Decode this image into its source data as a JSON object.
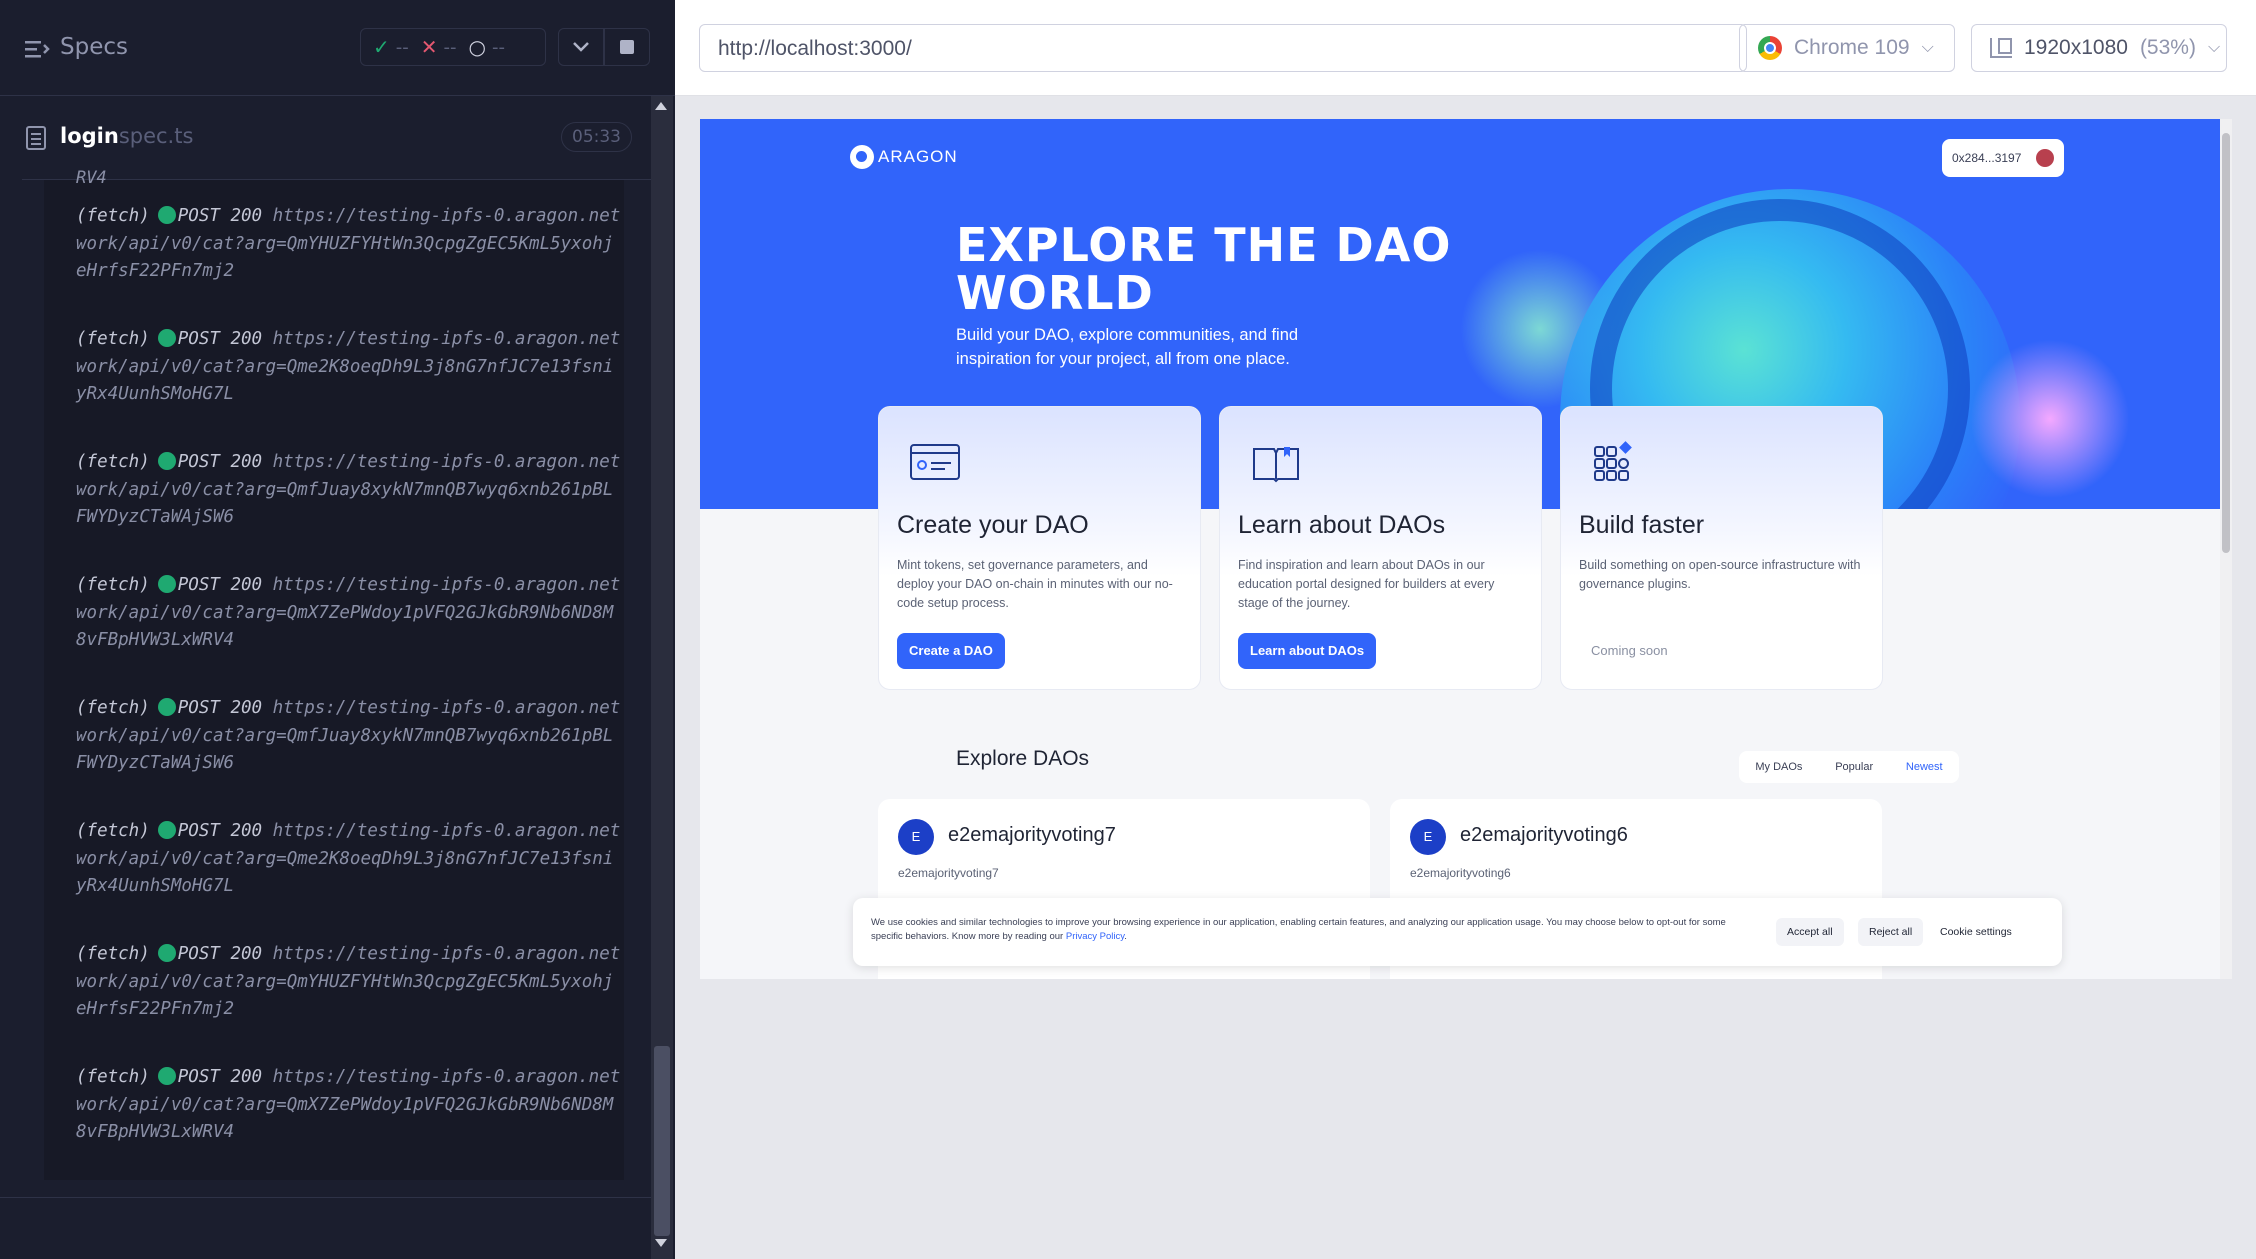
{
  "runner": {
    "title": "Specs",
    "stats": {
      "passed": "--",
      "failed": "--",
      "pending": "--"
    },
    "spec": {
      "name": "login",
      "ext": "spec.ts",
      "duration": "05:33"
    },
    "cut_line": "RV4",
    "logs": [
      {
        "tag": "(fetch)",
        "method": "POST 200",
        "url": "https://testing-ipfs-0.aragon.network/api/v0/cat?arg=QmYHUZFYHtWn3QcpgZgEC5KmL5yxohjeHrfsF22PFn7mj2"
      },
      {
        "tag": "(fetch)",
        "method": "POST 200",
        "url": "https://testing-ipfs-0.aragon.network/api/v0/cat?arg=Qme2K8oeqDh9L3j8nG7nfJC7e13fsniyRx4UunhSMoHG7L"
      },
      {
        "tag": "(fetch)",
        "method": "POST 200",
        "url": "https://testing-ipfs-0.aragon.network/api/v0/cat?arg=QmfJuay8xykN7mnQB7wyq6xnb261pBLFWYDyzCTaWAjSW6"
      },
      {
        "tag": "(fetch)",
        "method": "POST 200",
        "url": "https://testing-ipfs-0.aragon.network/api/v0/cat?arg=QmX7ZePWdoy1pVFQ2GJkGbR9Nb6ND8M8vFBpHVW3LxWRV4"
      },
      {
        "tag": "(fetch)",
        "method": "POST 200",
        "url": "https://testing-ipfs-0.aragon.network/api/v0/cat?arg=QmfJuay8xykN7mnQB7wyq6xnb261pBLFWYDyzCTaWAjSW6"
      },
      {
        "tag": "(fetch)",
        "method": "POST 200",
        "url": "https://testing-ipfs-0.aragon.network/api/v0/cat?arg=Qme2K8oeqDh9L3j8nG7nfJC7e13fsniyRx4UunhSMoHG7L"
      },
      {
        "tag": "(fetch)",
        "method": "POST 200",
        "url": "https://testing-ipfs-0.aragon.network/api/v0/cat?arg=QmYHUZFYHtWn3QcpgZgEC5KmL5yxohjeHrfsF22PFn7mj2"
      },
      {
        "tag": "(fetch)",
        "method": "POST 200",
        "url": "https://testing-ipfs-0.aragon.network/api/v0/cat?arg=QmX7ZePWdoy1pVFQ2GJkGbR9Nb6ND8M8vFBpHVW3LxWRV4"
      }
    ]
  },
  "aut": {
    "url": "http://localhost:3000/",
    "browser": "Chrome 109",
    "viewport": "1920x1080",
    "scale": "(53%)"
  },
  "app": {
    "logo_text": "ARAGON",
    "wallet": "0x284...3197",
    "hero_title": "EXPLORE THE DAO WORLD",
    "hero_sub": "Build your DAO, explore communities, and find inspiration for your project, all from one place.",
    "cards": [
      {
        "title": "Create your DAO",
        "desc": "Mint tokens, set governance parameters, and deploy your DAO on-chain in minutes with our no-code setup process.",
        "button": "Create a DAO",
        "icon": "browser-window-icon"
      },
      {
        "title": "Learn about DAOs",
        "desc": "Find inspiration and learn about DAOs in our education portal designed for builders at every stage of the journey.",
        "button": "Learn about DAOs",
        "icon": "open-book-icon"
      },
      {
        "title": "Build faster",
        "desc": "Build something on open-source infrastructure with governance plugins.",
        "button": "Coming soon",
        "icon": "blocks-grid-icon"
      }
    ],
    "explore_title": "Explore DAOs",
    "tabs": [
      "My DAOs",
      "Popular",
      "Newest"
    ],
    "active_tab": "Newest",
    "daos": [
      {
        "initial": "E",
        "name": "e2emajorityvoting7",
        "ens": "e2emajorityvoting7"
      },
      {
        "initial": "E",
        "name": "e2emajorityvoting6",
        "ens": "e2emajorityvoting6"
      }
    ],
    "cookie": {
      "text": "We use cookies and similar technologies to improve your browsing experience in our application, enabling certain features, and analyzing our application usage. You may choose below to opt-out for some specific behaviors. Know more by reading our",
      "link": "Privacy Policy",
      "text_end": ".",
      "accept": "Accept all",
      "reject": "Reject all",
      "settings": "Cookie settings"
    }
  },
  "colors": {
    "runner_bg": "#1b1e2e",
    "pass": "#1fa971",
    "fail": "#e45770",
    "brand_blue": "#3164fa"
  }
}
